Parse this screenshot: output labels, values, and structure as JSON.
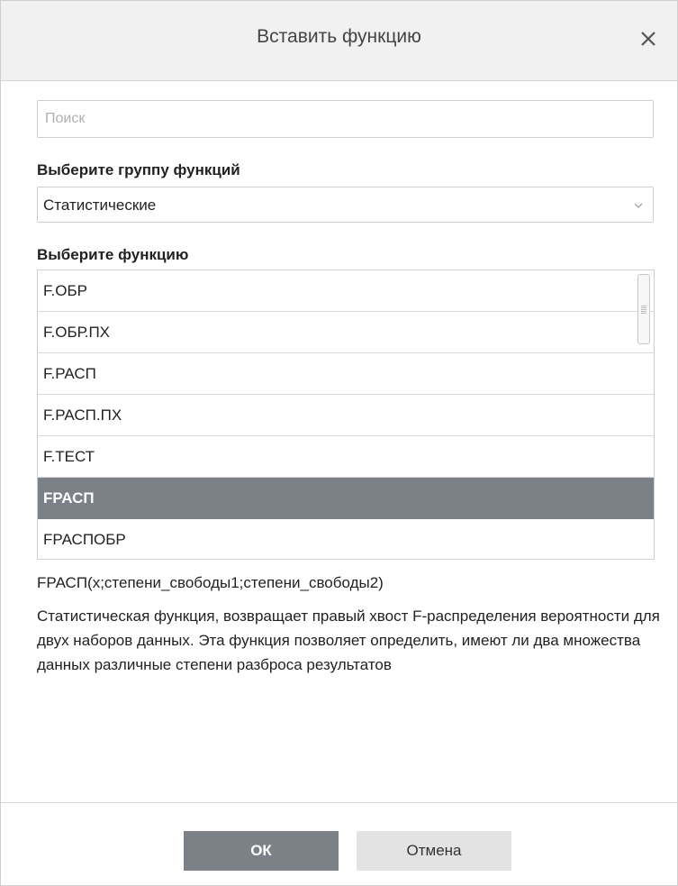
{
  "dialog": {
    "title": "Вставить функцию",
    "close_icon": "close-icon"
  },
  "search": {
    "placeholder": "Поиск",
    "value": ""
  },
  "group": {
    "label": "Выберите группу функций",
    "selected": "Статистические",
    "caret_icon": "chevron-down-icon"
  },
  "functions": {
    "label": "Выберите функцию",
    "items": [
      "F.ОБР",
      "F.ОБР.ПХ",
      "F.РАСП",
      "F.РАСП.ПХ",
      "F.ТЕСТ",
      "FРАСП",
      "FРАСПОБР"
    ],
    "selected": "FРАСП"
  },
  "details": {
    "syntax": "FРАСП(x;степени_свободы1;степени_свободы2)",
    "description": "Статистическая функция, возвращает правый хвост F-распределения вероятности для двух наборов данных. Эта функция позволяет определить, имеют ли два множества данных различные степени разброса результатов"
  },
  "footer": {
    "ok_label": "ОК",
    "cancel_label": "Отмена"
  },
  "colors": {
    "selected_row": "#7c8187",
    "ok_button": "#7c8187",
    "cancel_button": "#e3e3e3",
    "titlebar": "#f1f1f1"
  }
}
